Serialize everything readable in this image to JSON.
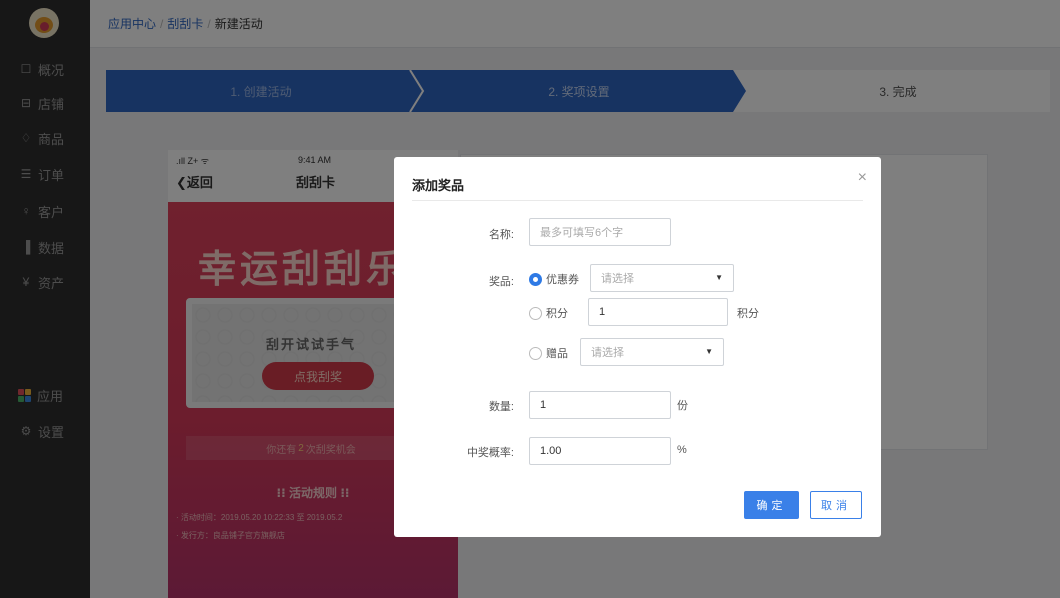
{
  "colors": {
    "sidebar": "#2f2f2f",
    "accent": "#2f66c2",
    "step_active": "#2f66c2",
    "primary_button": "#3a80e8",
    "poster": "#d83a5a"
  },
  "sidebar": {
    "logo_icon": "avatar-logo",
    "items": [
      {
        "icon": "chat-icon",
        "glyph": "☐",
        "label": "概况"
      },
      {
        "icon": "store-icon",
        "glyph": "⊟",
        "label": "店铺"
      },
      {
        "icon": "tag-icon",
        "glyph": "♢",
        "label": "商品"
      },
      {
        "icon": "order-icon",
        "glyph": "☰",
        "label": "订单"
      },
      {
        "icon": "user-icon",
        "glyph": "♀",
        "label": "客户"
      },
      {
        "icon": "chart-icon",
        "glyph": "▐",
        "label": "数据"
      },
      {
        "icon": "coin-icon",
        "glyph": "¥",
        "label": "资产"
      },
      {
        "icon": "apps-icon",
        "label": "应用"
      },
      {
        "icon": "gear-icon",
        "glyph": "⚙",
        "label": "设置"
      }
    ]
  },
  "breadcrumb": {
    "items": [
      "应用中心",
      "刮刮卡"
    ],
    "current": "新建活动",
    "separator": "/"
  },
  "steps": [
    {
      "label": "1. 创建活动",
      "state": "done"
    },
    {
      "label": "2. 奖项设置",
      "state": "active"
    },
    {
      "label": "3. 完成",
      "state": "todo"
    }
  ],
  "phone": {
    "carrier": ".ıll Z+ ᯤ",
    "time": "9:41 AM",
    "back": "返回",
    "title": "刮刮卡",
    "big_title": "幸运刮刮乐",
    "ticket_text": "刮开试试手气",
    "scratch_button": "点我刮奖",
    "chances_prefix": "你还有",
    "chances_count": "2",
    "chances_suffix": "次刮奖机会",
    "rules_title": "活动规则",
    "rules": [
      "· 活动时间：2019.05.20 10:22:33 至 2019.05.2",
      "· 发行方：良品铺子官方旗舰店"
    ]
  },
  "modal": {
    "title": "添加奖品",
    "close": "×",
    "name_label": "名称:",
    "name_placeholder": "最多可填写6个字",
    "prize_label": "奖品:",
    "options": [
      {
        "label": "优惠券",
        "selected": true,
        "select_placeholder": "请选择"
      },
      {
        "label": "积分",
        "selected": false,
        "value": "1",
        "unit": "积分"
      },
      {
        "label": "赠品",
        "selected": false,
        "select_placeholder": "请选择"
      }
    ],
    "quantity_label": "数量:",
    "quantity_value": "1",
    "quantity_unit": "份",
    "probability_label": "中奖概率:",
    "probability_value": "1.00",
    "probability_unit": "%",
    "confirm": "确定",
    "cancel": "取消"
  }
}
